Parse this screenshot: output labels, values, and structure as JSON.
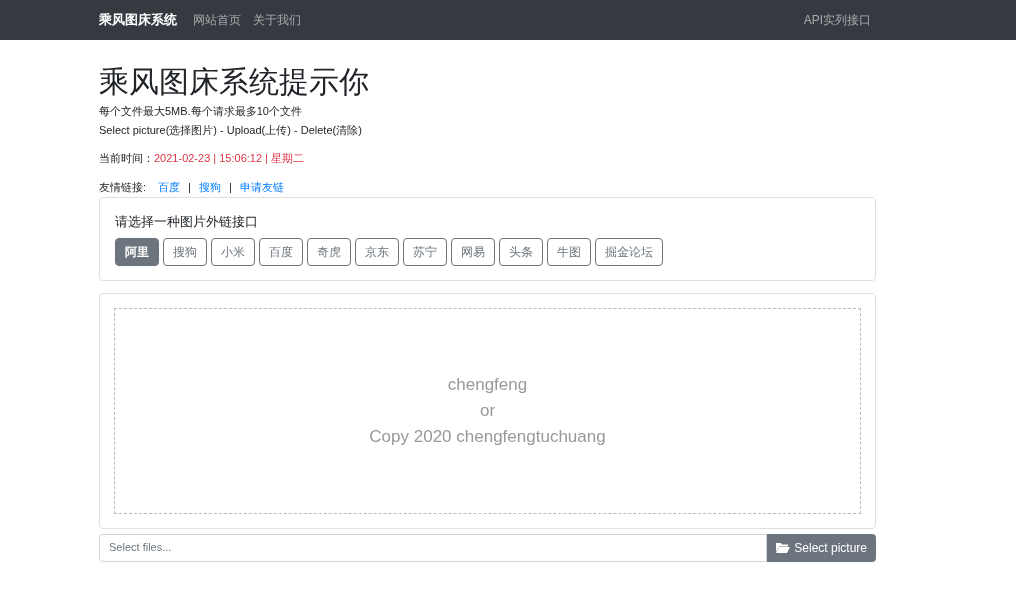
{
  "navbar": {
    "brand": "乘风图床系统",
    "links": [
      "网站首页",
      "关于我们"
    ],
    "right_link": "API实列接口"
  },
  "heading": "乘风图床系统提示你",
  "notes": [
    "每个文件最大5MB.每个请求最多10个文件",
    "Select picture(选择图片) - Upload(上传) - Delete(清除)"
  ],
  "time": {
    "label": "当前时间：",
    "value": "2021-02-23 | 15:06:12 | 星期二"
  },
  "friend_links": {
    "label": "友情链接:",
    "separator": "|",
    "links": [
      "百度",
      "搜狗",
      "申请友链"
    ]
  },
  "interface_card": {
    "title": "请选择一种图片外链接口",
    "options": [
      {
        "label": "阿里",
        "selected": true
      },
      {
        "label": "搜狗",
        "selected": false
      },
      {
        "label": "小米",
        "selected": false
      },
      {
        "label": "百度",
        "selected": false
      },
      {
        "label": "奇虎",
        "selected": false
      },
      {
        "label": "京东",
        "selected": false
      },
      {
        "label": "苏宁",
        "selected": false
      },
      {
        "label": "网易",
        "selected": false
      },
      {
        "label": "头条",
        "selected": false
      },
      {
        "label": "牛图",
        "selected": false
      },
      {
        "label": "掘金论坛",
        "selected": false
      }
    ]
  },
  "dropzone": {
    "lines": [
      "chengfeng",
      "or",
      "Copy 2020 chengfengtuchuang"
    ]
  },
  "file_input": {
    "placeholder": "Select files...",
    "button": "Select picture"
  }
}
